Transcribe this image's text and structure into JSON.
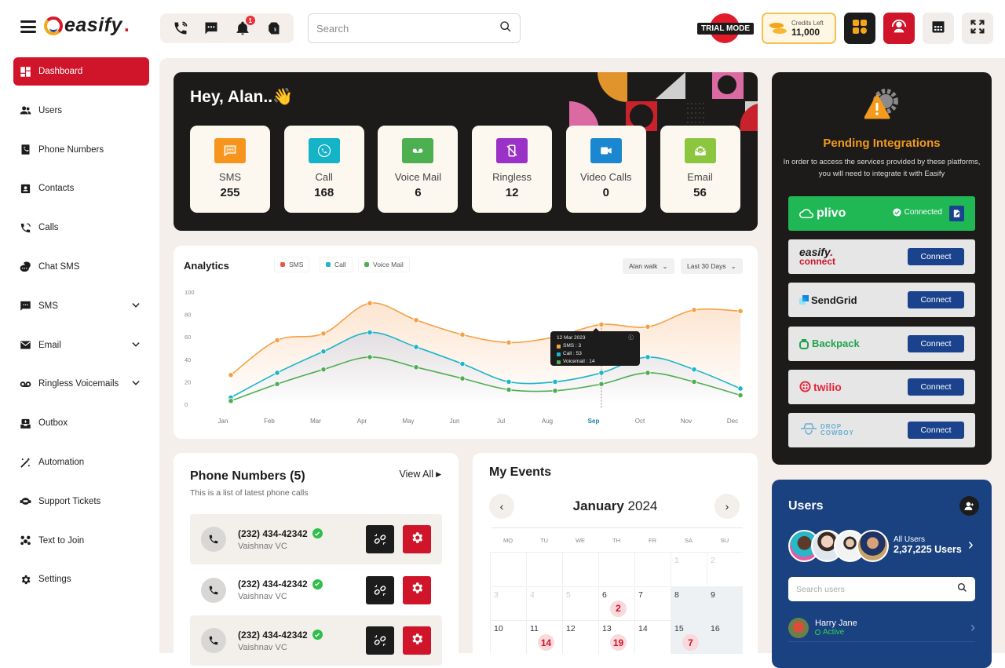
{
  "brand": {
    "name": "easify",
    "dot": "."
  },
  "header": {
    "quick_icons": [
      "phone-icon",
      "chat-icon",
      "bell-icon",
      "price-tag-icon"
    ],
    "notification_count": "1",
    "search": {
      "placeholder": "Search",
      "value": ""
    },
    "trial_label": "TRIAL MODE",
    "credits": {
      "label": "Credits Left",
      "value": "11,000"
    },
    "buttons": [
      "apps-icon",
      "support-agent-icon",
      "calendar-icon",
      "fullscreen-icon"
    ]
  },
  "sidebar": {
    "items": [
      {
        "label": "Dashboard",
        "icon": "dashboard-icon",
        "active": true
      },
      {
        "label": "Users",
        "icon": "users-icon"
      },
      {
        "label": "Phone Numbers",
        "icon": "phone-book-icon"
      },
      {
        "label": "Contacts",
        "icon": "contact-card-icon"
      },
      {
        "label": "Calls",
        "icon": "call-icon"
      },
      {
        "label": "Chat SMS",
        "icon": "chat-bubbles-icon"
      },
      {
        "label": "SMS",
        "icon": "message-icon",
        "expandable": true
      },
      {
        "label": "Email",
        "icon": "mail-icon",
        "expandable": true
      },
      {
        "label": "Ringless Voicemails",
        "icon": "voicemail-icon",
        "expandable": true
      },
      {
        "label": "Outbox",
        "icon": "outbox-icon"
      },
      {
        "label": "Automation",
        "icon": "magic-wand-icon"
      },
      {
        "label": "Support Tickets",
        "icon": "headset-icon"
      },
      {
        "label": "Text to Join",
        "icon": "group-icon"
      },
      {
        "label": "Settings",
        "icon": "gear-icon"
      }
    ]
  },
  "hero": {
    "greeting": "Hey, Alan..",
    "emoji": "👋",
    "stats": [
      {
        "label": "SMS",
        "value": "255",
        "color": "#f7941d",
        "icon": "sms-icon"
      },
      {
        "label": "Call",
        "value": "168",
        "color": "#14b3c8",
        "icon": "call-icon"
      },
      {
        "label": "Voice Mail",
        "value": "6",
        "color": "#4caf50",
        "icon": "voicemail-icon"
      },
      {
        "label": "Ringless",
        "value": "12",
        "color": "#9b32c7",
        "icon": "no-phone-icon"
      },
      {
        "label": "Video Calls",
        "value": "0",
        "color": "#1a87d0",
        "icon": "video-icon"
      },
      {
        "label": "Email",
        "value": "56",
        "color": "#8cc63f",
        "icon": "email-open-icon"
      }
    ]
  },
  "analytics": {
    "title": "Analytics",
    "filters": {
      "user": "Alan walk",
      "range": "Last 30 Days"
    },
    "tooltip": {
      "date": "12 Mar 2023",
      "rows": [
        "SMS : 3",
        "Call : 53",
        "Voicemail : 14"
      ]
    }
  },
  "chart_data": {
    "type": "line",
    "title": "Analytics",
    "xlabel": "",
    "ylabel": "",
    "categories": [
      "Jan",
      "Feb",
      "Mar",
      "Apr",
      "May",
      "Jun",
      "Jul",
      "Aug",
      "Sep",
      "Oct",
      "Nov",
      "Dec"
    ],
    "highlighted_category": "Sep",
    "y_ticks": [
      0,
      20,
      40,
      60,
      80,
      100
    ],
    "ylim": [
      0,
      100
    ],
    "legend": "top-left",
    "series": [
      {
        "name": "SMS",
        "color": "#f5a043",
        "legend_color": "#e8574a",
        "values": [
          26,
          57,
          63,
          90,
          75,
          62,
          55,
          60,
          71,
          69,
          84,
          83
        ]
      },
      {
        "name": "Call",
        "color": "#1ab6c9",
        "legend_color": "#1ab6c9",
        "values": [
          6,
          28,
          47,
          64,
          51,
          36,
          20,
          20,
          28,
          42,
          31,
          14
        ]
      },
      {
        "name": "Voice Mail",
        "color": "#4fae52",
        "legend_color": "#4fae52",
        "values": [
          3,
          18,
          31,
          42,
          33,
          23,
          13,
          12,
          18,
          28,
          20,
          8
        ]
      }
    ]
  },
  "phones": {
    "title": "Phone Numbers (5)",
    "subtitle": "This is a list of latest phone calls",
    "view_all": "View All",
    "rows": [
      {
        "number": "(232) 434-42342",
        "name": "Vaishnav VC"
      },
      {
        "number": "(232) 434-42342",
        "name": "Vaishnav VC"
      },
      {
        "number": "(232) 434-42342",
        "name": "Vaishnav VC"
      }
    ]
  },
  "events": {
    "title": "My Events",
    "month": "January",
    "year": "2024",
    "weekdays": [
      "MO",
      "TU",
      "WE",
      "TH",
      "FR",
      "SA",
      "SU"
    ],
    "weeks": [
      [
        {
          "d": ""
        },
        {
          "d": ""
        },
        {
          "d": ""
        },
        {
          "d": ""
        },
        {
          "d": ""
        },
        {
          "d": "1",
          "faded": true
        },
        {
          "d": "2",
          "faded": true
        }
      ],
      [
        {
          "d": "3",
          "faded": true
        },
        {
          "d": "4",
          "faded": true
        },
        {
          "d": "5",
          "faded": true
        },
        {
          "d": "6",
          "count": "2"
        },
        {
          "d": "7"
        },
        {
          "d": "8"
        },
        {
          "d": "9"
        }
      ],
      [
        {
          "d": "10"
        },
        {
          "d": "11",
          "count": "14"
        },
        {
          "d": "12"
        },
        {
          "d": "13",
          "count": "19"
        },
        {
          "d": "14"
        },
        {
          "d": "15",
          "count": "7"
        },
        {
          "d": "16"
        }
      ]
    ]
  },
  "integrations": {
    "title": "Pending Integrations",
    "description": "In order to access the services provided by these platforms, you will need to integrate it with Easify",
    "items": [
      {
        "name": "plivo",
        "status": "Connected"
      },
      {
        "name": "easify. connect",
        "button": "Connect"
      },
      {
        "name": "SendGrid",
        "button": "Connect"
      },
      {
        "name": "Backpack",
        "button": "Connect"
      },
      {
        "name": "twilio",
        "button": "Connect"
      },
      {
        "name": "DROP COWBOY",
        "button": "Connect"
      }
    ]
  },
  "users": {
    "title": "Users",
    "all_label": "All Users",
    "count": "2,37,225 Users",
    "search_placeholder": "Search users",
    "list": [
      {
        "name": "Harry Jane",
        "status": "Active"
      }
    ]
  }
}
